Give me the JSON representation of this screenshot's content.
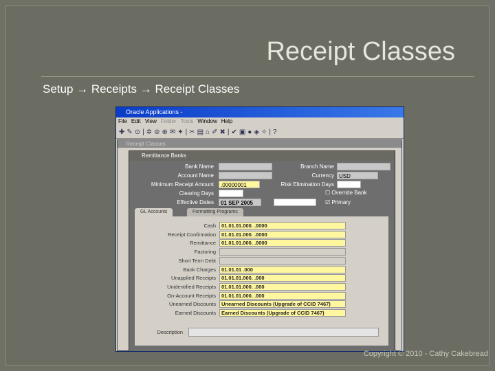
{
  "slide": {
    "title": "Receipt Classes",
    "breadcrumb": [
      "Setup",
      "Receipts",
      "Receipt Classes"
    ],
    "arrow": "→",
    "copyright": "Copyright © 2010 - Cathy Cakebread"
  },
  "app": {
    "title": "Oracle Applications -",
    "menu": [
      "File",
      "Edit",
      "View",
      "Folder",
      "Tools",
      "Window",
      "Help"
    ],
    "window_title": "Receipt Classes",
    "inner_title": "Remittance Banks",
    "header_fields": [
      {
        "label": "Bank Name",
        "value": ""
      },
      {
        "label": "Branch Name",
        "value": ""
      },
      {
        "label": "Account Name",
        "value": ""
      },
      {
        "label": "Currency",
        "value": "USD"
      },
      {
        "label": "Minimum Receipt Amount",
        "value": ".00000001"
      },
      {
        "label": "Risk Elimination Days",
        "value": ""
      },
      {
        "label": "Clearing Days",
        "value": ""
      },
      {
        "label": "Override Bank",
        "value": ""
      },
      {
        "label": "Effective Dates",
        "value": "01 SEP 2005"
      },
      {
        "label": "Primary",
        "value": ""
      }
    ],
    "override_bank_checked": false,
    "primary_checked": true,
    "tabs": [
      "GL Accounts",
      "Formatting Programs"
    ],
    "gl_accounts": [
      {
        "label": "Cash",
        "value": "01.01.01.000.        .0000"
      },
      {
        "label": "Receipt Confirmation",
        "value": "01.01.01.000.        .0000"
      },
      {
        "label": "Remittance",
        "value": "01.01.01.000.        .0000"
      },
      {
        "label": "Factoring",
        "value": ""
      },
      {
        "label": "Short Term Debt",
        "value": ""
      },
      {
        "label": "Bank Charges",
        "value": "01.01.01                .000"
      },
      {
        "label": "Unapplied Receipts",
        "value": "01.01.01.000.        .000"
      },
      {
        "label": "Unidentified Receipts",
        "value": "01.01.01.000.        .000"
      },
      {
        "label": "On-Account Receipts",
        "value": "01.01.01.000.        .000"
      },
      {
        "label": "Unearned Discounts",
        "value": "Unearned Discounts (Upgrade of CCID 7467)"
      },
      {
        "label": "Earned Discounts",
        "value": "Earned Discounts (Upgrade of CCID 7467)"
      }
    ],
    "description_label": "Description",
    "description": ""
  }
}
